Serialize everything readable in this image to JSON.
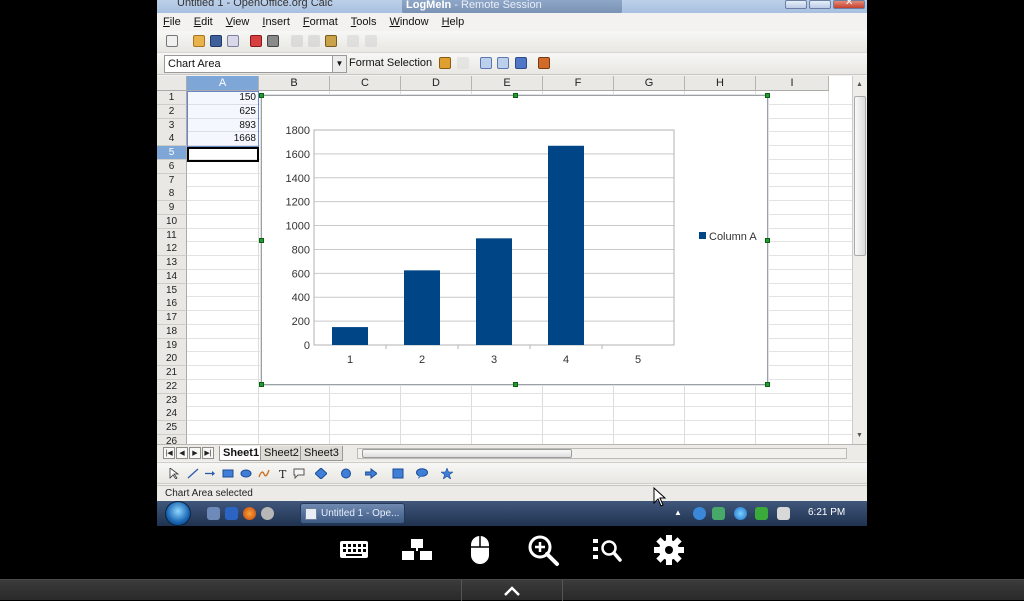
{
  "window": {
    "app_title": "Untitled 1 - OpenOffice.org Calc",
    "remote_title": "LogMeIn",
    "remote_subtitle": "- Remote Session"
  },
  "menu": [
    "File",
    "Edit",
    "View",
    "Insert",
    "Format",
    "Tools",
    "Window",
    "Help"
  ],
  "toolbar": {
    "chart_element": "Chart Area",
    "format_selection": "Format Selection"
  },
  "sheet": {
    "columns": [
      "A",
      "B",
      "C",
      "D",
      "E",
      "F",
      "G",
      "H",
      "I"
    ],
    "rows": [
      "1",
      "2",
      "3",
      "4",
      "5",
      "6",
      "7",
      "8",
      "9",
      "10",
      "11",
      "12",
      "13",
      "14",
      "15",
      "16",
      "17",
      "18",
      "19",
      "20",
      "21",
      "22",
      "23",
      "24",
      "25",
      "26"
    ],
    "active_column": "A",
    "active_row": "5",
    "cells": [
      {
        "ref": "A1",
        "value": "150"
      },
      {
        "ref": "A2",
        "value": "625"
      },
      {
        "ref": "A3",
        "value": "893"
      },
      {
        "ref": "A4",
        "value": "1668"
      }
    ]
  },
  "chart_data": {
    "type": "bar",
    "categories": [
      "1",
      "2",
      "3",
      "4",
      "5"
    ],
    "series": [
      {
        "name": "Column A",
        "values": [
          150,
          625,
          893,
          1668,
          null
        ],
        "color": "#004586"
      }
    ],
    "title": "",
    "xlabel": "",
    "ylabel": "",
    "ylim": [
      0,
      1800
    ],
    "yticks": [
      "0",
      "200",
      "400",
      "600",
      "800",
      "1000",
      "1200",
      "1400",
      "1600",
      "1800"
    ],
    "grid": true,
    "legend": "right"
  },
  "tabs": [
    "Sheet1",
    "Sheet2",
    "Sheet3"
  ],
  "active_tab": "Sheet1",
  "status": {
    "text": "Chart Area selected"
  },
  "taskbar": {
    "task_label": "Untitled 1 - Ope...",
    "clock": "6:21 PM"
  },
  "colors": {
    "series": "#004586",
    "selection": "#7ea7d8",
    "handle": "#1f9b2f"
  },
  "remote_controls": {
    "icons": [
      "keyboard-icon",
      "display-icon",
      "mouse-icon",
      "zoom-in-icon",
      "zoom-fit-icon",
      "gear-icon"
    ]
  }
}
